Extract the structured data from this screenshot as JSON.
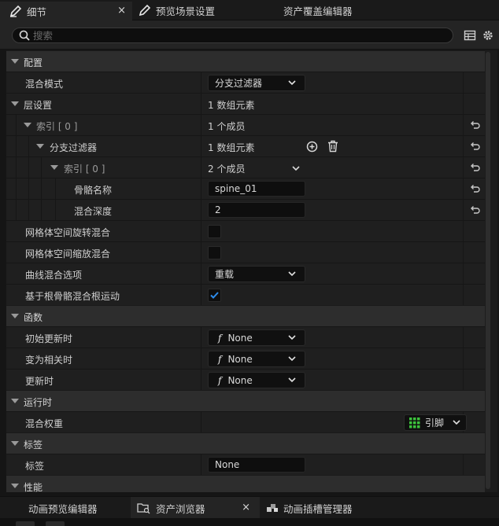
{
  "tabs": [
    {
      "label": "细节",
      "icon": "pencil-icon",
      "active": true,
      "close": "×"
    },
    {
      "label": "预览场景设置",
      "icon": "pencil-icon",
      "active": false
    },
    {
      "label": "资产覆盖编辑器",
      "icon": "",
      "active": false
    }
  ],
  "search": {
    "placeholder": "搜索"
  },
  "toolbar": {
    "icons": [
      "table-view-icon",
      "settings-icon"
    ]
  },
  "sections": {
    "config": {
      "label": "配置"
    },
    "functions": {
      "label": "函数"
    },
    "runtime": {
      "label": "运行时"
    },
    "tags": {
      "label": "标签"
    },
    "performance": {
      "label": "性能"
    }
  },
  "props": {
    "blend_mode": {
      "label": "混合模式",
      "value": "分支过滤器"
    },
    "layer_setup": {
      "label": "层设置",
      "value": "1 数组元素"
    },
    "index0": {
      "label": "索引 [ 0 ]",
      "value": "1 个成员"
    },
    "branch_filters": {
      "label": "分支过滤器",
      "value": "1 数组元素"
    },
    "index0_inner": {
      "label": "索引 [ 0 ]",
      "value": "2 个成员"
    },
    "bone_name": {
      "label": "骨骼名称",
      "value": "spine_01"
    },
    "blend_depth": {
      "label": "混合深度",
      "value": "2"
    },
    "mesh_rot_blend": {
      "label": "网格体空间旋转混合",
      "checked": false
    },
    "mesh_scale_blend": {
      "label": "网格体空间缩放混合",
      "checked": false
    },
    "curve_blend": {
      "label": "曲线混合选项",
      "value": "重载"
    },
    "root_motion": {
      "label": "基于根骨骼混合根运动",
      "checked": true
    },
    "initial_update": {
      "label": "初始更新时",
      "value": "None",
      "fn": "f"
    },
    "become_relevant": {
      "label": "变为相关时",
      "value": "None",
      "fn": "f"
    },
    "on_update": {
      "label": "更新时",
      "value": "None",
      "fn": "f"
    },
    "blend_weights": {
      "label": "混合权重",
      "value": "引脚"
    },
    "tag": {
      "label": "标签",
      "value": "None"
    }
  },
  "bottom_tabs": [
    {
      "label": "动画预览编辑器",
      "active": false
    },
    {
      "label": "资产浏览器",
      "icon": "folder-search-icon",
      "active": true,
      "close": "×"
    },
    {
      "label": "动画插槽管理器",
      "icon": "montage-icon",
      "active": false
    }
  ],
  "colors": {
    "accent_check": "#2d8ceb",
    "pin_green": "#3cc23c"
  }
}
